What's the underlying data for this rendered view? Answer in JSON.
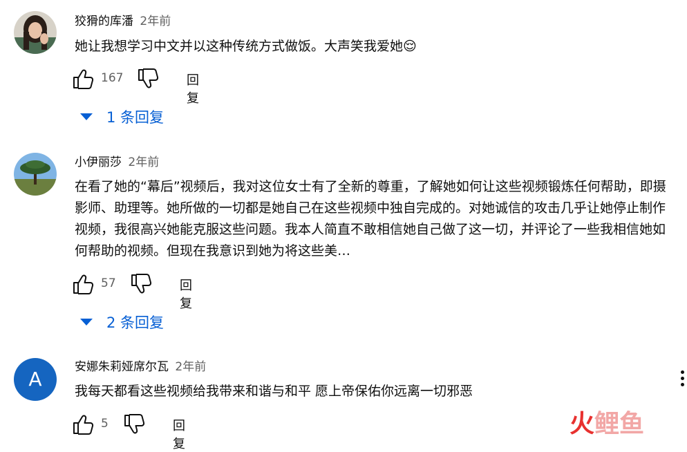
{
  "comments": [
    {
      "author": "狡猾的库潘",
      "time": "2年前",
      "text": "她让我想学习中文并以这种传统方式做饭。大声笑我爱她😌",
      "likes": "167",
      "reply_label": "回复",
      "replies_label": "1 条回复"
    },
    {
      "author": "小伊丽莎",
      "time": "2年前",
      "text": "在看了她的“幕后”视频后，我对这位女士有了全新的尊重，了解她如何让这些视频锻炼任何帮助，即摄影师、助理等。她所做的一切都是她自己在这些视频中独自完成的。对她诚信的攻击几乎让她停止制作视频，我很高兴她能克服这些问题。我本人简直不敢相信她自己做了这一切，并评论了一些我相信她如何帮助的视频。但现在我意识到她为将这些美…",
      "likes": "57",
      "reply_label": "回复",
      "replies_label": "2 条回复"
    },
    {
      "author": "安娜朱莉娅席尔瓦",
      "time": "2年前",
      "avatar_letter": "A",
      "text": "我每天都看这些视频给我带来和谐与和平 愿上帝保佑你远离一切邪恶",
      "likes": "5",
      "reply_label": "回复"
    }
  ],
  "watermark": {
    "chars": [
      "火",
      "鲤",
      "鱼"
    ],
    "colors": [
      "#e8312f",
      "#f2a7a6",
      "#f2a7a6"
    ]
  },
  "colors": {
    "link_blue": "#065fd4",
    "secondary_text": "#606060",
    "avatar_blue": "#1565c0"
  }
}
